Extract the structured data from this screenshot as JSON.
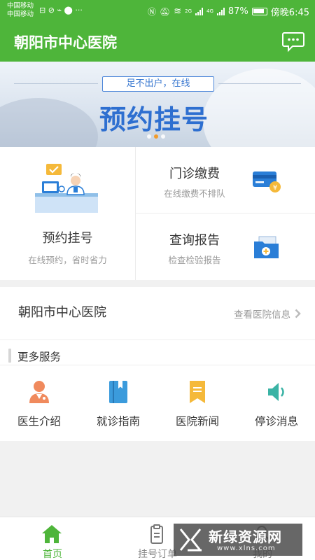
{
  "status_bar": {
    "carrier1": "中国移动",
    "carrier2": "中国移动",
    "extra_icons": "⊟ ⊘ ⌁ ⬤ ···",
    "network_2g": "2G",
    "network_4g": "4G",
    "battery": "87%",
    "time": "傍晚6:45"
  },
  "header": {
    "title": "朝阳市中心医院",
    "message_icon": "chat-bubble-icon"
  },
  "banner": {
    "tagline": "足不出户，在线",
    "headline": "预约挂号",
    "active_slide": 2,
    "slides": 3
  },
  "services_main": {
    "register": {
      "label": "预约挂号",
      "sub": "在线预约，省时省力"
    },
    "payment": {
      "label": "门诊缴费",
      "sub": "在线缴费不排队"
    },
    "report": {
      "label": "查询报告",
      "sub": "检查检验报告"
    }
  },
  "hospital": {
    "name": "朝阳市中心医院",
    "info_link": "查看医院信息"
  },
  "more_services": {
    "title": "更多服务",
    "items": [
      {
        "label": "医生介绍",
        "icon": "doctor-icon"
      },
      {
        "label": "就诊指南",
        "icon": "guide-book-icon"
      },
      {
        "label": "医院新闻",
        "icon": "news-bookmark-icon"
      },
      {
        "label": "停诊消息",
        "icon": "speaker-icon"
      }
    ]
  },
  "bottom_nav": {
    "items": [
      {
        "label": "首页",
        "icon": "home-icon",
        "active": true
      },
      {
        "label": "挂号订单",
        "icon": "clipboard-icon",
        "active": false
      },
      {
        "label": "我的",
        "icon": "user-icon",
        "active": false
      }
    ]
  },
  "watermark": {
    "name": "新绿资源网",
    "url": "www.xlns.com"
  },
  "colors": {
    "brand": "#4eb53a",
    "banner_blue": "#2e6fd0",
    "slide_dot_active": "#f29b2b"
  }
}
